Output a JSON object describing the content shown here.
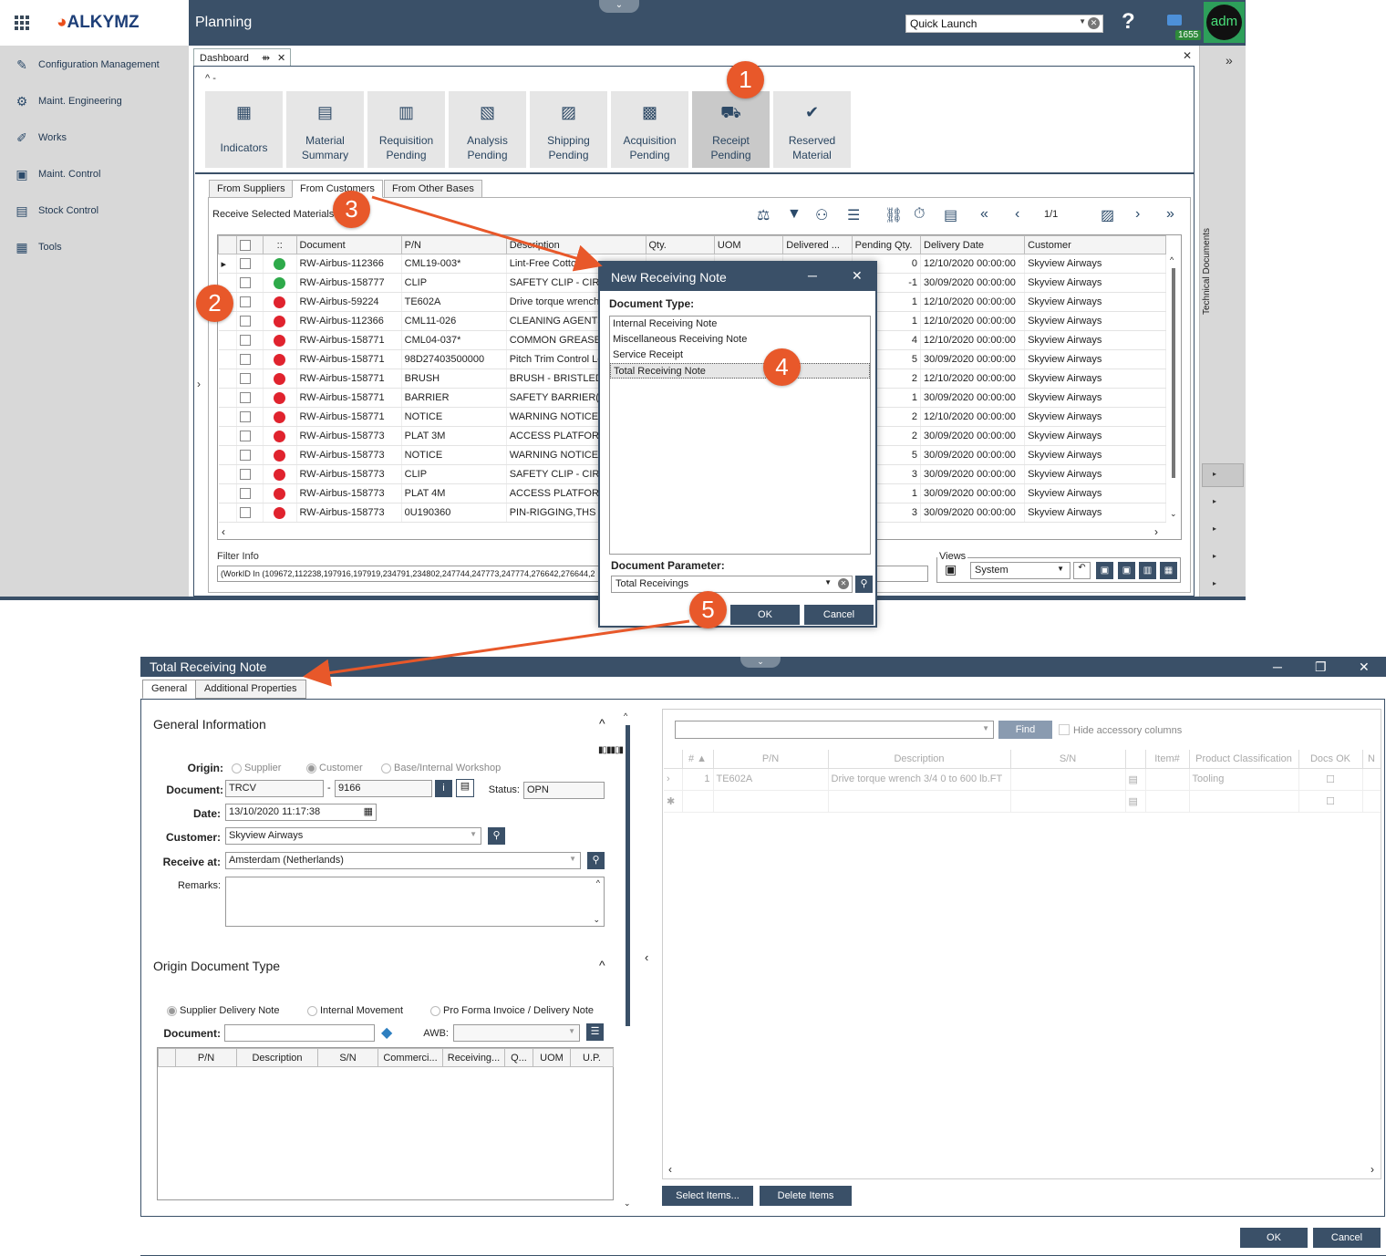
{
  "app": {
    "logo": "ALKYMZ",
    "module_title": "Planning",
    "quick_launch": "Quick Launch",
    "help": "?",
    "notification_count": "1655",
    "avatar": "adm"
  },
  "sidebar": {
    "items": [
      {
        "label": "Configuration Management",
        "icon": "pencil-icon"
      },
      {
        "label": "Maint. Engineering",
        "icon": "engineering-icon"
      },
      {
        "label": "Works",
        "icon": "works-icon"
      },
      {
        "label": "Maint. Control",
        "icon": "control-icon"
      },
      {
        "label": "Stock Control",
        "icon": "stock-icon"
      },
      {
        "label": "Tools",
        "icon": "tools-icon"
      }
    ]
  },
  "right_panel": {
    "label": "Technical Documents"
  },
  "dashboard": {
    "tab_label": "Dashboard",
    "tiles": [
      {
        "label": "Indicators"
      },
      {
        "label": "Material Summary"
      },
      {
        "label": "Requisition Pending"
      },
      {
        "label": "Analysis Pending"
      },
      {
        "label": "Shipping Pending"
      },
      {
        "label": "Acquisition Pending"
      },
      {
        "label": "Receipt Pending"
      },
      {
        "label": "Reserved Material"
      }
    ],
    "subtabs": [
      "From Suppliers",
      "From Customers",
      "From Other Bases"
    ],
    "receive_label": "Receive Selected Materials",
    "page_info": "1/1",
    "columns": [
      "::",
      "Document",
      "P/N",
      "Description",
      "Qty.",
      "UOM",
      "Delivered ...",
      "Pending Qty.",
      "Delivery Date",
      "Customer"
    ],
    "rows": [
      {
        "status": "green",
        "doc": "RW-Airbus-112366",
        "pn": "CML19-003*",
        "desc": "Lint-Free Cotton Gl",
        "pending": "0",
        "date": "12/10/2020 00:00:00",
        "customer": "Skyview Airways"
      },
      {
        "status": "green",
        "doc": "RW-Airbus-158777",
        "pn": "CLIP",
        "desc": "SAFETY CLIP - CIRCU",
        "pending": "-1",
        "date": "30/09/2020 00:00:00",
        "customer": "Skyview Airways"
      },
      {
        "status": "red",
        "doc": "RW-Airbus-59224",
        "pn": "TE602A",
        "desc": "Drive torque wrench",
        "pending": "1",
        "date": "12/10/2020 00:00:00",
        "customer": "Skyview Airways"
      },
      {
        "status": "red",
        "doc": "RW-Airbus-112366",
        "pn": "CML11-026",
        "desc": "CLEANING AGENTS S",
        "pending": "1",
        "date": "12/10/2020 00:00:00",
        "customer": "Skyview Airways"
      },
      {
        "status": "red",
        "doc": "RW-Airbus-158771",
        "pn": "CML04-037*",
        "desc": "COMMON GREASES:",
        "pending": "4",
        "date": "12/10/2020 00:00:00",
        "customer": "Skyview Airways"
      },
      {
        "status": "red",
        "doc": "RW-Airbus-158771",
        "pn": "98D27403500000",
        "desc": "Pitch Trim Control Loc",
        "pending": "5",
        "date": "30/09/2020 00:00:00",
        "customer": "Skyview Airways"
      },
      {
        "status": "red",
        "doc": "RW-Airbus-158771",
        "pn": "BRUSH",
        "desc": "BRUSH - BRISTLED",
        "pending": "2",
        "date": "12/10/2020 00:00:00",
        "customer": "Skyview Airways"
      },
      {
        "status": "red",
        "doc": "RW-Airbus-158771",
        "pn": "BARRIER",
        "desc": "SAFETY BARRIER(S)",
        "pending": "1",
        "date": "30/09/2020 00:00:00",
        "customer": "Skyview Airways"
      },
      {
        "status": "red",
        "doc": "RW-Airbus-158771",
        "pn": "NOTICE",
        "desc": "WARNING NOTICE(S)",
        "pending": "2",
        "date": "12/10/2020 00:00:00",
        "customer": "Skyview Airways"
      },
      {
        "status": "red",
        "doc": "RW-Airbus-158773",
        "pn": "PLAT 3M",
        "desc": "ACCESS PLATFORM 3",
        "pending": "2",
        "date": "30/09/2020 00:00:00",
        "customer": "Skyview Airways"
      },
      {
        "status": "red",
        "doc": "RW-Airbus-158773",
        "pn": "NOTICE",
        "desc": "WARNING NOTICE(S)",
        "pending": "5",
        "date": "30/09/2020 00:00:00",
        "customer": "Skyview Airways"
      },
      {
        "status": "red",
        "doc": "RW-Airbus-158773",
        "pn": "CLIP",
        "desc": "SAFETY CLIP - CIRCU",
        "pending": "3",
        "date": "30/09/2020 00:00:00",
        "customer": "Skyview Airways"
      },
      {
        "status": "red",
        "doc": "RW-Airbus-158773",
        "pn": "PLAT 4M",
        "desc": "ACCESS PLATFORM 4",
        "pending": "1",
        "date": "30/09/2020 00:00:00",
        "customer": "Skyview Airways"
      },
      {
        "status": "red",
        "doc": "RW-Airbus-158773",
        "pn": "0U190360",
        "desc": "PIN-RIGGING,THS AC",
        "pending": "3",
        "date": "30/09/2020 00:00:00",
        "customer": "Skyview Airways"
      }
    ],
    "filter_label": "Filter Info",
    "filter_text": "(WorkID In (109672,112238,197916,197919,234791,234802,247744,247773,247774,276642,276644,2",
    "views_label": "Views",
    "views_value": "System"
  },
  "dialog": {
    "title": "New Receiving Note",
    "doc_type_label": "Document Type:",
    "doc_types": [
      "Internal Receiving Note",
      "Miscellaneous Receiving Note",
      "Service Receipt",
      "Total Receiving Note"
    ],
    "param_label": "Document Parameter:",
    "param_value": "Total Receivings",
    "ok": "OK",
    "cancel": "Cancel"
  },
  "callouts": [
    "1",
    "2",
    "3",
    "4",
    "5"
  ],
  "total_note": {
    "title": "Total Receiving Note",
    "tabs": [
      "General",
      "Additional Properties"
    ],
    "general_info": "General Information",
    "origin_label": "Origin:",
    "origin_options": [
      "Supplier",
      "Customer",
      "Base/Internal Workshop"
    ],
    "document_label": "Document:",
    "doc_prefix": "TRCV",
    "doc_sep": "-",
    "doc_number": "9166",
    "status_label": "Status:",
    "status_value": "OPN",
    "date_label": "Date:",
    "date_value": "13/10/2020 11:17:38",
    "customer_label": "Customer:",
    "customer_value": "Skyview Airways",
    "receive_at_label": "Receive at:",
    "receive_at_value": "Amsterdam (Netherlands)",
    "remarks_label": "Remarks:",
    "origin_doc_type": "Origin Document Type",
    "odt_options": [
      "Supplier Delivery Note",
      "Internal Movement",
      "Pro Forma Invoice / Delivery Note"
    ],
    "odt_document_label": "Document:",
    "awb_label": "AWB:",
    "odt_columns": [
      "P/N",
      "Description",
      "S/N",
      "Commerci...",
      "Receiving...",
      "Q...",
      "UOM",
      "U.P."
    ],
    "find": "Find",
    "hide_accessory": "Hide accessory columns",
    "right_columns": [
      "#",
      "P/N",
      "Description",
      "S/N",
      "",
      "Item#",
      "Product Classification",
      "Docs OK",
      "N"
    ],
    "right_rows": [
      {
        "num": "1",
        "pn": "TE602A",
        "desc": "Drive torque wrench 3/4 0 to 600 lb.FT",
        "classification": "Tooling"
      }
    ],
    "select_items": "Select Items...",
    "delete_items": "Delete Items",
    "ok": "OK",
    "cancel": "Cancel"
  },
  "colors": {
    "brand": "#3a5068",
    "callout": "#e8582a",
    "status_green": "#2eaa4a",
    "status_red": "#e0232e"
  }
}
